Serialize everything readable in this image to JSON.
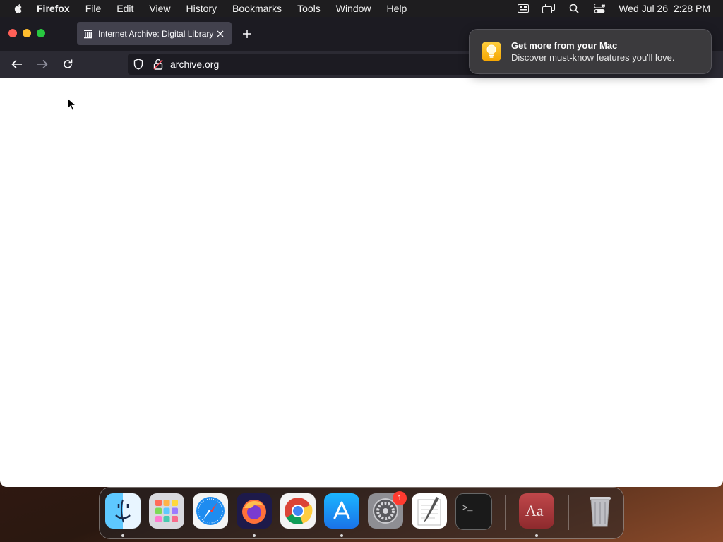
{
  "menubar": {
    "app_name": "Firefox",
    "items": [
      "File",
      "Edit",
      "View",
      "History",
      "Bookmarks",
      "Tools",
      "Window",
      "Help"
    ],
    "clock": "Wed Jul 26  2:28 PM",
    "status_icons": [
      "keyboard-input-icon",
      "screen-mirroring-icon",
      "spotlight-search-icon",
      "control-center-icon"
    ]
  },
  "browser": {
    "tab": {
      "title": "Internet Archive: Digital Library",
      "favicon": "archive-building-icon"
    },
    "address": "archive.org"
  },
  "notification": {
    "title": "Get more from your Mac",
    "body": "Discover must-know features you'll love.",
    "icon": "lightbulb-icon"
  },
  "dock": {
    "apps": [
      "Finder",
      "Launchpad",
      "Safari",
      "Firefox",
      "Google Chrome",
      "App Store",
      "System Settings",
      "TextEdit",
      "Terminal",
      "Dictionary",
      "Trash"
    ],
    "badge_count": "1"
  },
  "colors": {
    "tab_bar": "#1c1b22",
    "nav_bar": "#2b2a33",
    "active_tab": "#42414d",
    "notification_bg": "#3b3a3d",
    "badge": "#ff3b30"
  }
}
